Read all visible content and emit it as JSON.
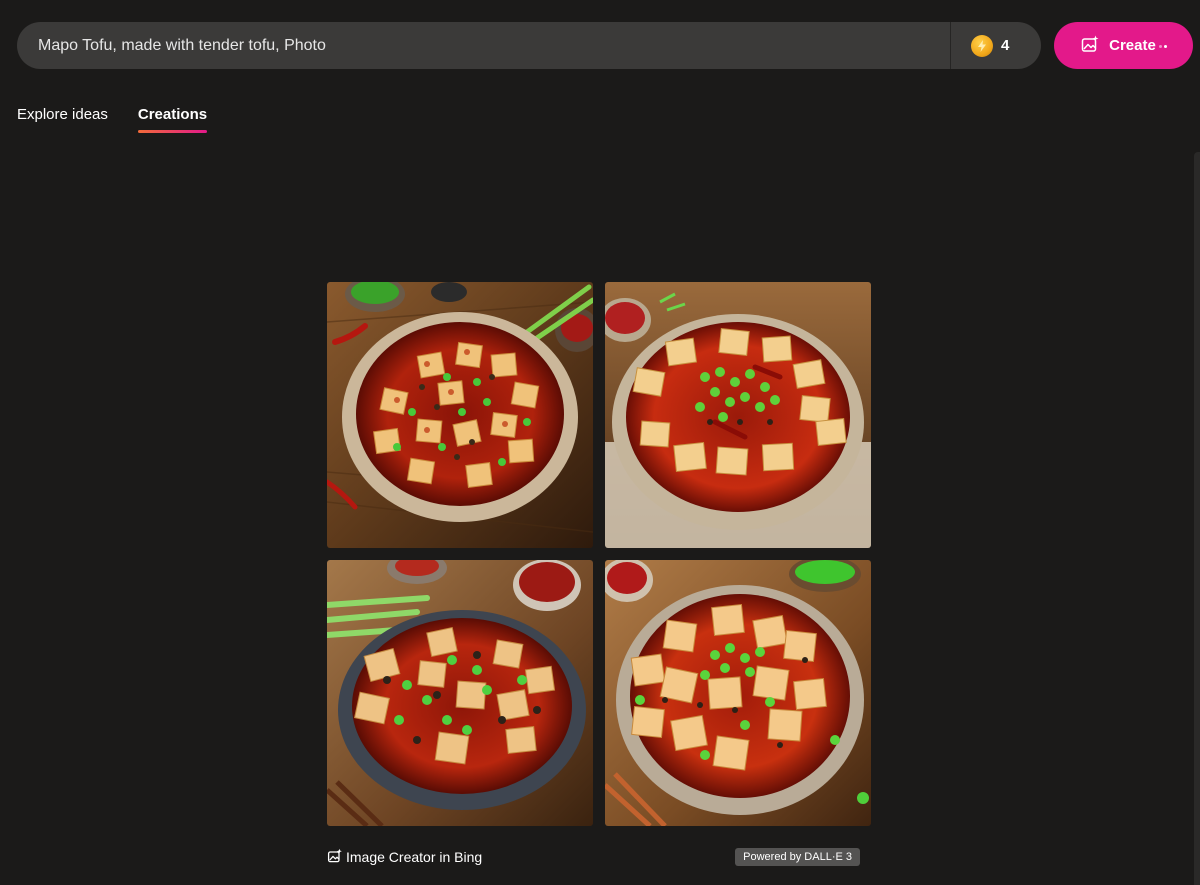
{
  "prompt": {
    "value": "Mapo Tofu, made with tender tofu, Photo",
    "icon": "boost-coin-icon",
    "boost_count": "4"
  },
  "create_button": {
    "label": "Create",
    "icon": "image-sparkle-icon",
    "color": "#e3198a"
  },
  "tabs": [
    {
      "label": "Explore ideas",
      "active": false
    },
    {
      "label": "Creations",
      "active": true
    }
  ],
  "images": [
    {
      "name": "generated-image-1",
      "subject": "Mapo tofu bowl with green onions and chili"
    },
    {
      "name": "generated-image-2",
      "subject": "Mapo tofu bowl with green onions and dried chili"
    },
    {
      "name": "generated-image-3",
      "subject": "Mapo tofu in a grey bowl with scallions"
    },
    {
      "name": "generated-image-4",
      "subject": "Mapo tofu with chopped green onions"
    }
  ],
  "footer": {
    "brand_label": "Image Creator in Bing",
    "brand_icon": "image-sparkle-icon",
    "badge_label": "Powered by DALL·E 3"
  },
  "colors": {
    "background": "#1b1a19",
    "prompt_bar": "#3b3a39",
    "accent": "#e3198a"
  }
}
